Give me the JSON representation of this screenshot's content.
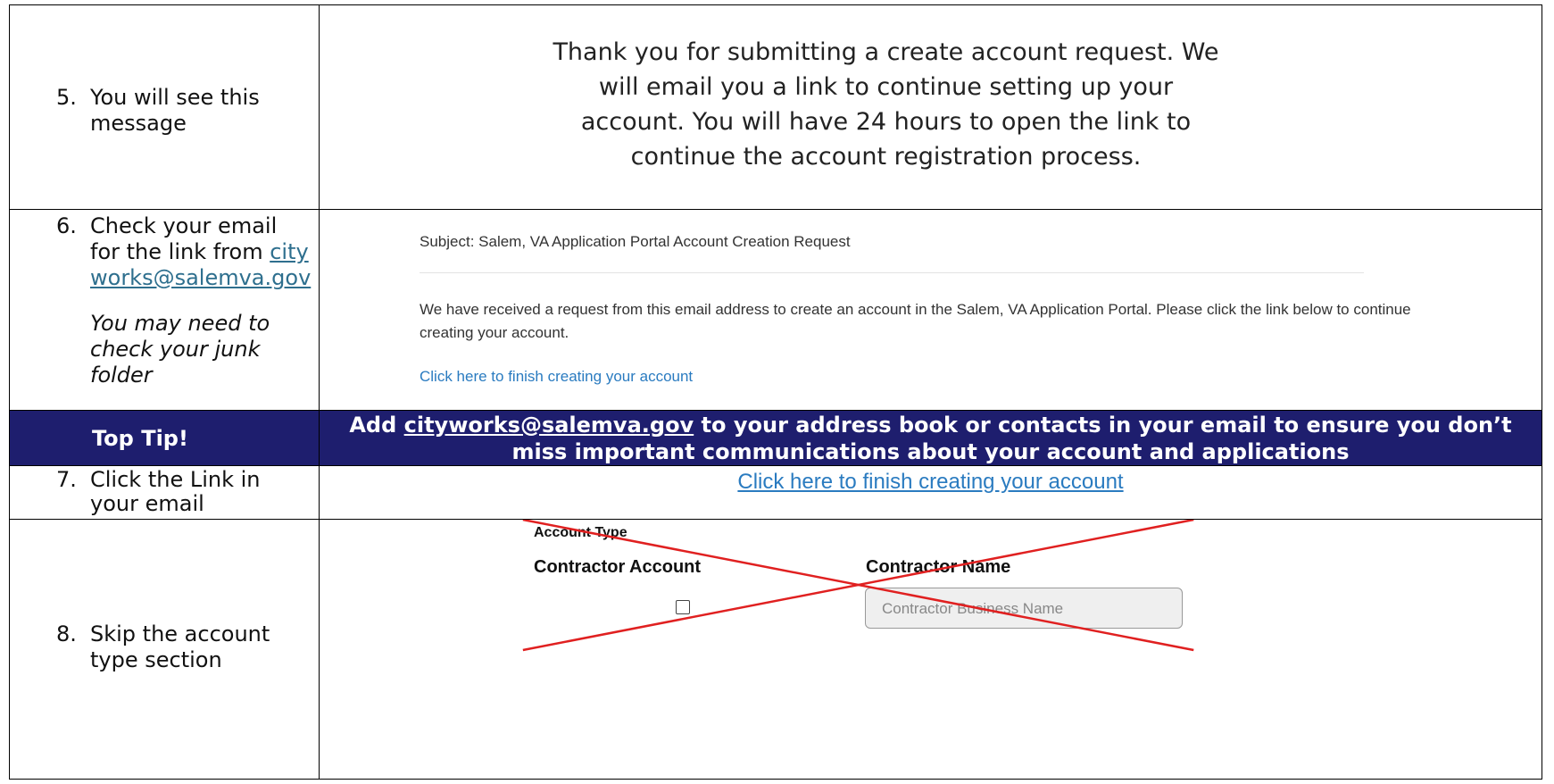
{
  "rows": {
    "step5": {
      "num": "5.",
      "text": "You will see this message",
      "message": "Thank you for submitting a create account request. We will email you a link to continue setting up your account. You will have 24 hours to open the link to continue the account registration process."
    },
    "step6": {
      "num": "6.",
      "text_before": "Check your email for the link from ",
      "email": "cityworks@salemva.gov",
      "note": "You may need to check your junk folder",
      "preview": {
        "subject": "Subject: Salem, VA Application Portal Account Creation Request",
        "body": "We have received a request from this email address to create an account in the Salem, VA Application Portal. Please click the link below to continue creating your account.",
        "link": "Click here to finish creating your account"
      }
    },
    "tip": {
      "label": "Top Tip!",
      "before": "Add ",
      "email": "cityworks@salemva.gov",
      "after": " to your address book or contacts in your email to ensure you don’t miss important communications about your account and applications"
    },
    "step7": {
      "num": "7.",
      "text": "Click the Link in your email",
      "link": "Click here to finish creating your account"
    },
    "step8": {
      "num": "8.",
      "text": "Skip the account type section",
      "form": {
        "section": "Account Type",
        "contractor_account": "Contractor Account",
        "contractor_name": "Contractor Name",
        "placeholder": "Contractor Business Name"
      }
    }
  },
  "colors": {
    "tip_bg": "#1e1e6e",
    "link": "#2a7bc0",
    "cross": "#e02020"
  }
}
